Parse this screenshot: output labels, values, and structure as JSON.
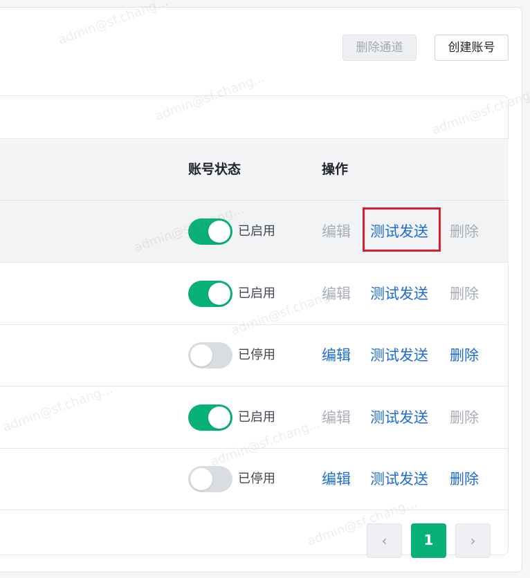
{
  "toolbar": {
    "delete_channel_label": "删除通道",
    "create_account_label": "创建账号"
  },
  "table": {
    "columns": [
      "账号状态",
      "操作"
    ],
    "rows": [
      {
        "enabled": true,
        "status": "已启用",
        "edit": "编辑",
        "test": "测试发送",
        "delete": "删除"
      },
      {
        "enabled": true,
        "status": "已启用",
        "edit": "编辑",
        "test": "测试发送",
        "delete": "删除"
      },
      {
        "enabled": false,
        "status": "已停用",
        "edit": "编辑",
        "test": "测试发送",
        "delete": "删除"
      },
      {
        "enabled": true,
        "status": "已启用",
        "edit": "编辑",
        "test": "测试发送",
        "delete": "删除"
      },
      {
        "enabled": false,
        "status": "已停用",
        "edit": "编辑",
        "test": "测试发送",
        "delete": "删除"
      }
    ]
  },
  "pagination": {
    "prev_icon": "‹",
    "current_page": "1",
    "next_icon": "›"
  },
  "watermark": "admin@sf.chang...",
  "colors": {
    "accent_green": "#07b075",
    "link_blue": "#1d6bd8",
    "highlight_red": "#d81e2a"
  }
}
